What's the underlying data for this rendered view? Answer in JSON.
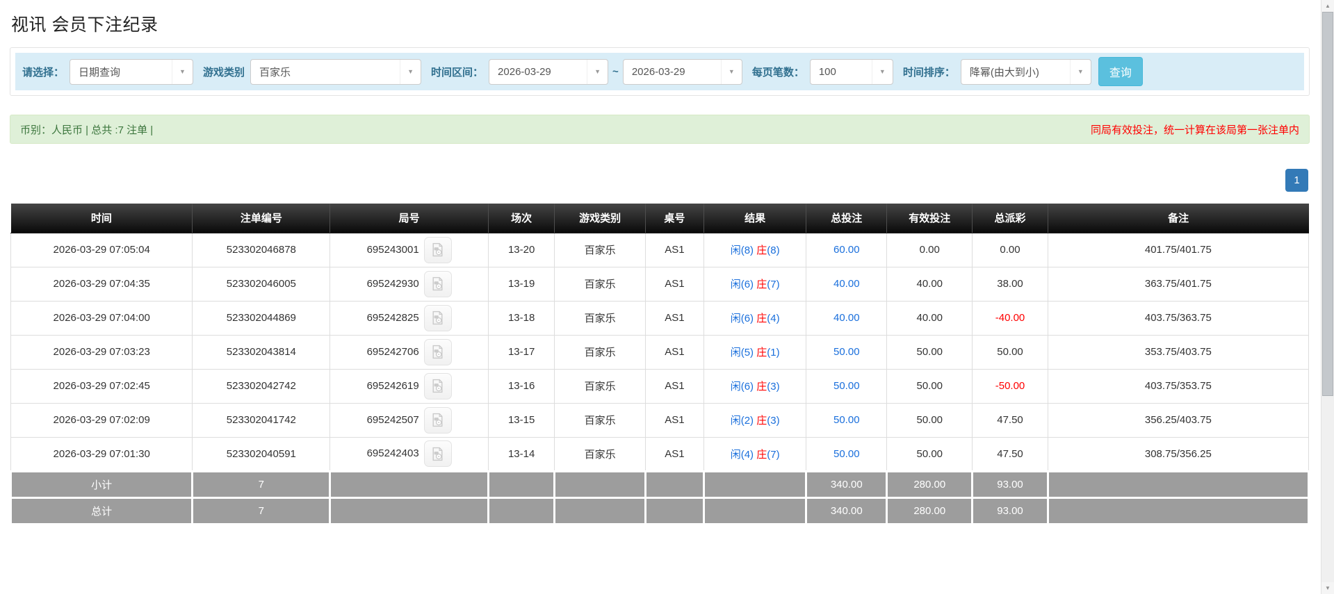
{
  "page": {
    "title": "视讯 会员下注纪录"
  },
  "filters": {
    "query_label": "请选择：",
    "query_value": "日期查询",
    "game_label": "游戏类别",
    "game_value": "百家乐",
    "range_label": "时间区间：",
    "date_from": "2026-03-29",
    "range_separator": "~",
    "date_to": "2026-03-29",
    "size_label": "每页笔数：",
    "size_value": "100",
    "sort_label": "时间排序：",
    "sort_value": "降幂(由大到小)",
    "search_button": "查询"
  },
  "summary": {
    "left_text": "币别：人民币 | 总共 :7 注单 |",
    "right_notice": "同局有效投注，统一计算在该局第一张注单内"
  },
  "pagination": {
    "current": "1"
  },
  "icons": {
    "chevron_down": "▼",
    "scroll_up": "▲",
    "scroll_down": "▼",
    "video": "video-file-icon"
  },
  "table": {
    "headers": [
      "时间",
      "注单编号",
      "局号",
      "场次",
      "游戏类别",
      "桌号",
      "结果",
      "总投注",
      "有效投注",
      "总派彩",
      "备注"
    ],
    "rows": [
      {
        "time": "2026-03-29 07:05:04",
        "bet_id": "523302046878",
        "round_id": "695243001",
        "session": "13-20",
        "game": "百家乐",
        "table_no": "AS1",
        "player": "闲(8)",
        "banker": "庄",
        "banker_num": "(8)",
        "total_bet": "60.00",
        "valid_bet": "0.00",
        "payout": "0.00",
        "remark": "401.75/401.75"
      },
      {
        "time": "2026-03-29 07:04:35",
        "bet_id": "523302046005",
        "round_id": "695242930",
        "session": "13-19",
        "game": "百家乐",
        "table_no": "AS1",
        "player": "闲(6)",
        "banker": "庄",
        "banker_num": "(7)",
        "total_bet": "40.00",
        "valid_bet": "40.00",
        "payout": "38.00",
        "remark": "363.75/401.75"
      },
      {
        "time": "2026-03-29 07:04:00",
        "bet_id": "523302044869",
        "round_id": "695242825",
        "session": "13-18",
        "game": "百家乐",
        "table_no": "AS1",
        "player": "闲(6)",
        "banker": "庄",
        "banker_num": "(4)",
        "total_bet": "40.00",
        "valid_bet": "40.00",
        "payout": "-40.00",
        "remark": "403.75/363.75"
      },
      {
        "time": "2026-03-29 07:03:23",
        "bet_id": "523302043814",
        "round_id": "695242706",
        "session": "13-17",
        "game": "百家乐",
        "table_no": "AS1",
        "player": "闲(5)",
        "banker": "庄",
        "banker_num": "(1)",
        "total_bet": "50.00",
        "valid_bet": "50.00",
        "payout": "50.00",
        "remark": "353.75/403.75"
      },
      {
        "time": "2026-03-29 07:02:45",
        "bet_id": "523302042742",
        "round_id": "695242619",
        "session": "13-16",
        "game": "百家乐",
        "table_no": "AS1",
        "player": "闲(6)",
        "banker": "庄",
        "banker_num": "(3)",
        "total_bet": "50.00",
        "valid_bet": "50.00",
        "payout": "-50.00",
        "remark": "403.75/353.75"
      },
      {
        "time": "2026-03-29 07:02:09",
        "bet_id": "523302041742",
        "round_id": "695242507",
        "session": "13-15",
        "game": "百家乐",
        "table_no": "AS1",
        "player": "闲(2)",
        "banker": "庄",
        "banker_num": "(3)",
        "total_bet": "50.00",
        "valid_bet": "50.00",
        "payout": "47.50",
        "remark": "356.25/403.75"
      },
      {
        "time": "2026-03-29 07:01:30",
        "bet_id": "523302040591",
        "round_id": "695242403",
        "session": "13-14",
        "game": "百家乐",
        "table_no": "AS1",
        "player": "闲(4)",
        "banker": "庄",
        "banker_num": "(7)",
        "total_bet": "50.00",
        "valid_bet": "50.00",
        "payout": "47.50",
        "remark": "308.75/356.25"
      }
    ],
    "subtotal": {
      "label": "小计",
      "count": "7",
      "total_bet": "340.00",
      "valid_bet": "280.00",
      "payout": "93.00"
    },
    "total": {
      "label": "总计",
      "count": "7",
      "total_bet": "340.00",
      "valid_bet": "280.00",
      "payout": "93.00"
    }
  },
  "colors": {
    "filter_bg": "#d9edf7",
    "filter_label": "#31708f",
    "search_button_bg": "#5bc0de",
    "summary_bg": "#dff0d8",
    "summary_text": "#3c763d",
    "notice_red": "#ff0000",
    "pagination_blue": "#337ab7",
    "amount_blue": "#1a6fdc",
    "negative_red": "#ff0000",
    "header_bg": "#1a1a1a",
    "footer_gray": "#9d9d9d"
  }
}
